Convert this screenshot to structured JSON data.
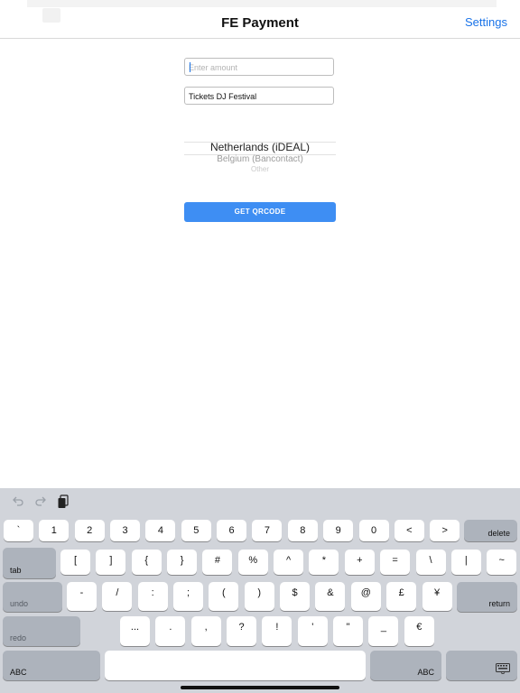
{
  "navbar": {
    "title": "FE Payment",
    "settings_label": "Settings"
  },
  "form": {
    "amount_placeholder": "Enter amount",
    "amount_value": "",
    "description_value": "Tickets DJ Festival"
  },
  "payment_picker": {
    "selected": "Netherlands (iDEAL)",
    "options": [
      "Netherlands (iDEAL)",
      "Belgium (Bancontact)",
      "Other"
    ]
  },
  "qr_button_label": "GET QRCODE",
  "keyboard": {
    "toolbar_icons": [
      "undo-arrow-icon",
      "redo-arrow-icon",
      "clipboard-paste-icon"
    ],
    "row1": [
      "`",
      "1",
      "2",
      "3",
      "4",
      "5",
      "6",
      "7",
      "8",
      "9",
      "0",
      "<",
      ">"
    ],
    "delete": "delete",
    "tab": "tab",
    "row2": [
      "[",
      "]",
      "{",
      "}",
      "#",
      "%",
      "^",
      "*",
      "+",
      "=",
      "\\",
      "|",
      "~"
    ],
    "undo": "undo",
    "row3": [
      "-",
      "/",
      ":",
      ";",
      "(",
      ")",
      "$",
      "&",
      "@",
      "£",
      "¥"
    ],
    "return": "return",
    "redo": "redo",
    "row4": [
      "...",
      ".",
      ",",
      "?",
      "!",
      "'",
      "\"",
      "_",
      "€"
    ],
    "abc_left": "ABC",
    "abc_right": "ABC",
    "dismiss_icon": "keyboard-dismiss-icon"
  }
}
